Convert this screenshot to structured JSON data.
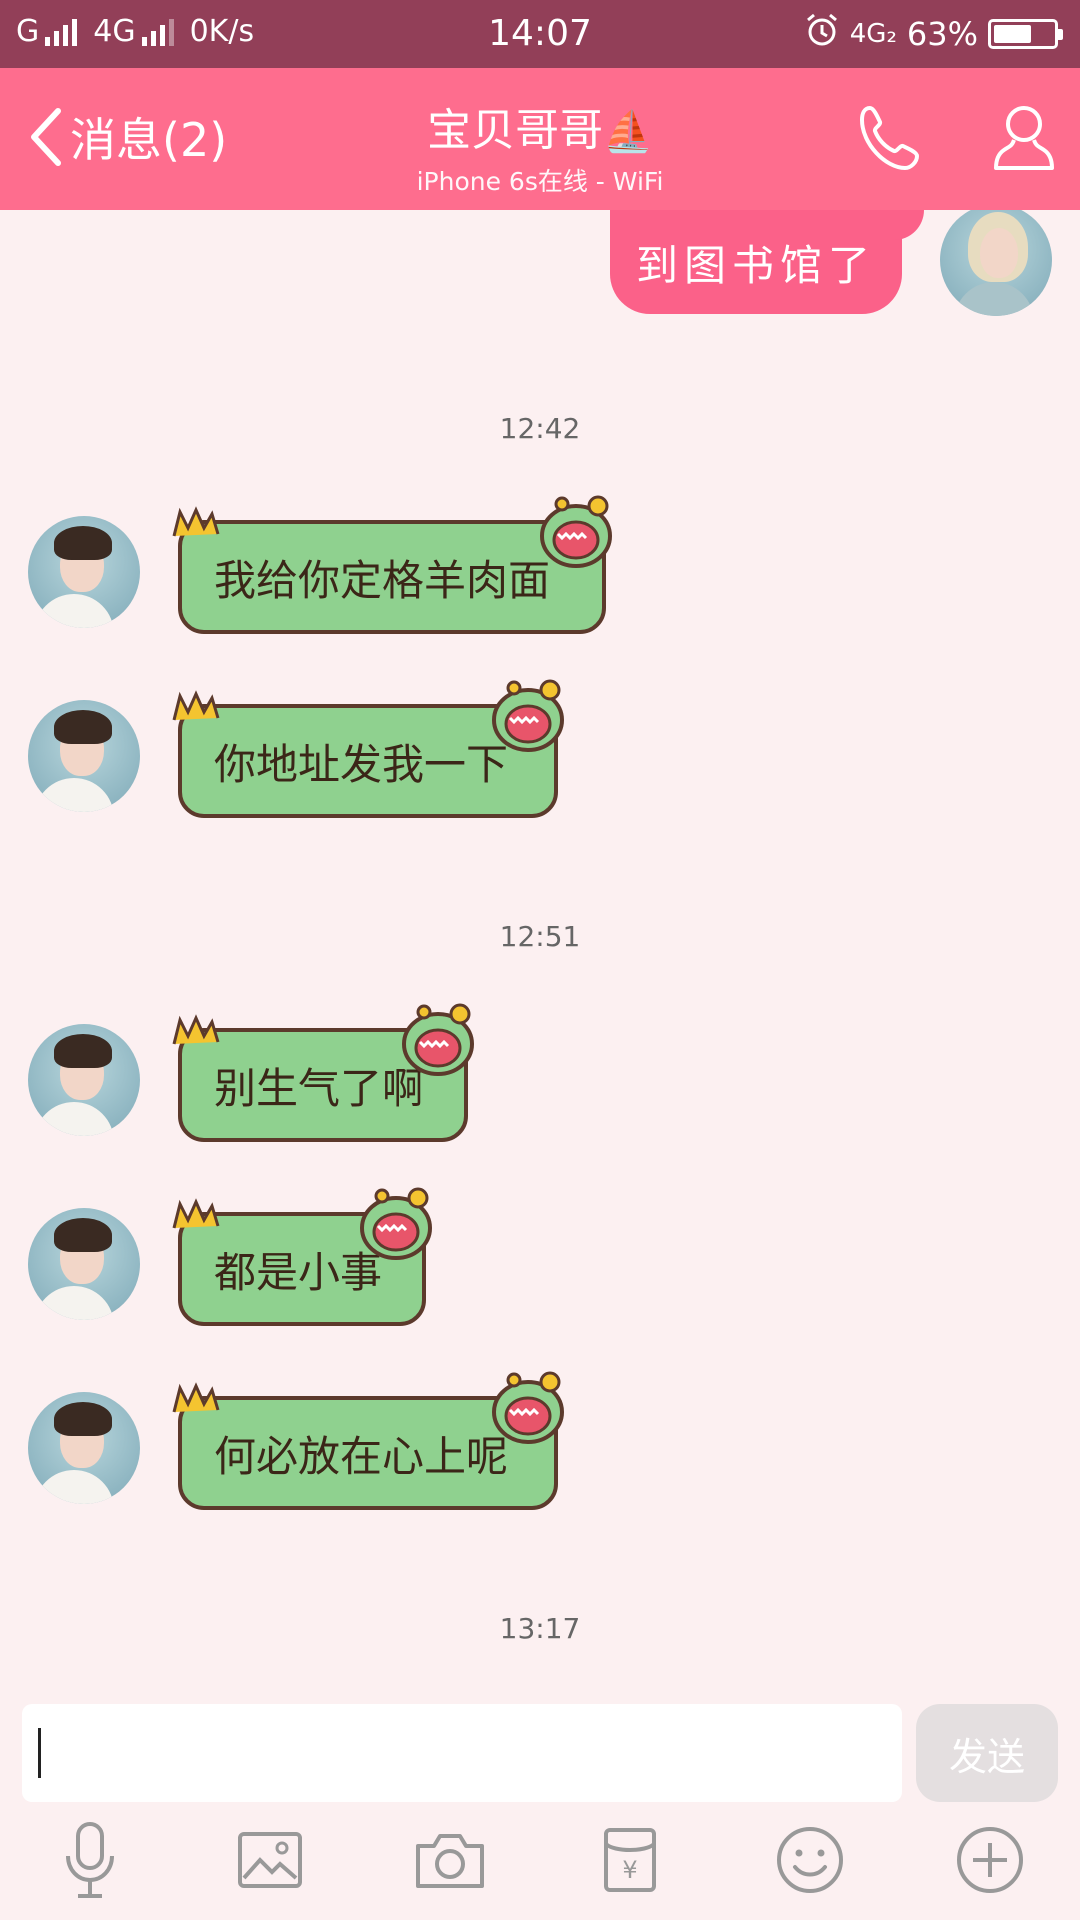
{
  "status_bar": {
    "carrier": "G",
    "network2": "4G",
    "speed": "0K/s",
    "time": "14:07",
    "network_right": "4G₂",
    "battery": "63%",
    "battery_level": 0.63
  },
  "header": {
    "back_label": "消息(2)",
    "title": "宝贝哥哥",
    "title_emoji": "⛵",
    "subtitle": "iPhone 6s在线 - WiFi"
  },
  "messages": {
    "my_message": "到图书馆了",
    "ts1": "12:42",
    "m1": "我给你定格羊肉面",
    "m2": "你地址发我一下",
    "ts2": "12:51",
    "m3": "别生气了啊",
    "m4": "都是小事",
    "m5": "何必放在心上呢",
    "ts3": "13:17"
  },
  "input": {
    "value": "",
    "send_label": "发送"
  },
  "toolbar": {
    "icons": [
      "microphone-icon",
      "image-icon",
      "camera-icon",
      "red-packet-icon",
      "emoji-icon",
      "plus-icon"
    ]
  },
  "colors": {
    "status_bar": "#923f58",
    "nav_bar": "#fe6d8e",
    "my_bubble": "#fb6189",
    "their_bubble": "#8fd18f",
    "background": "#fcf0f1"
  }
}
